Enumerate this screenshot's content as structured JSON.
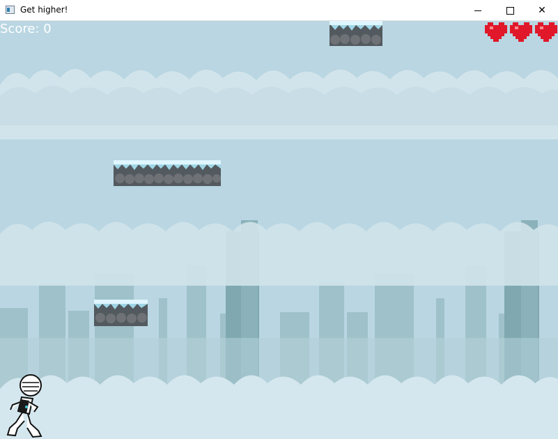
{
  "window": {
    "title": "Get higher!"
  },
  "hud": {
    "score_label": "Score: 0",
    "lives": 3
  },
  "icons": {
    "app": "window-app-icon",
    "heart": "heart-icon",
    "minimize": "minimize-icon",
    "maximize": "maximize-icon",
    "close": "close-icon"
  },
  "colors": {
    "sky": "#b9d6e2",
    "clouds": "#d8e8ef",
    "city": "#8fb3bb",
    "heart": "#e0182a",
    "rock": "#5b5f63",
    "ice": "#dff6ff"
  }
}
